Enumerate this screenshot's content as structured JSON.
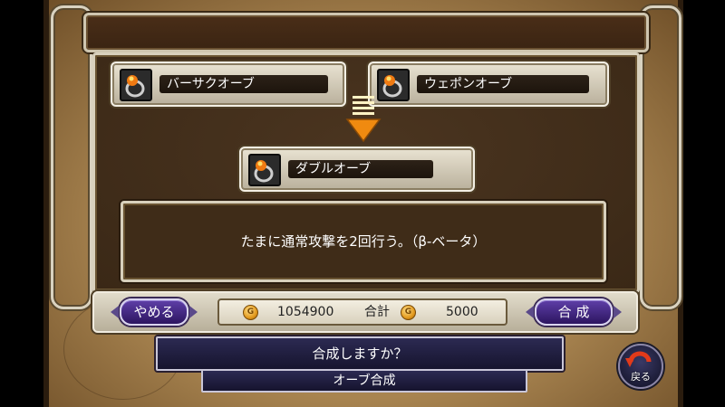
{
  "items": {
    "source_left": {
      "label": "バーサクオーブ",
      "icon": "orb-ring-icon"
    },
    "source_right": {
      "label": "ウェポンオーブ",
      "icon": "orb-ring-icon"
    },
    "result": {
      "label": "ダブルオーブ",
      "icon": "orb-ring-icon"
    }
  },
  "description": "たまに通常攻撃を2回行う。（β-ベータ）",
  "buttons": {
    "cancel": "やめる",
    "synthesize": "合 成",
    "back": "戻る"
  },
  "currency": {
    "owned": "1054900",
    "total_label": "合計",
    "cost": "5000",
    "coin_icon": "gold-coin-icon"
  },
  "confirm_prompt": "合成しますか？",
  "screen_title": "オーブ合成",
  "colors": {
    "panel": "#3a2816",
    "button_purple": "#4a2e8a",
    "arrow_orange": "#f08a10",
    "confirm_bar": "#1f1d3e"
  }
}
